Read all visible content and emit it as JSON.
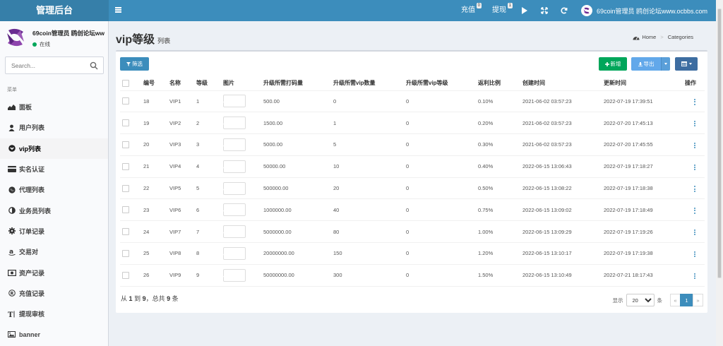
{
  "header": {
    "brand": "管理后台",
    "recharge": {
      "label": "充值",
      "badge": "0"
    },
    "withdraw": {
      "label": "提现",
      "badge": "1"
    },
    "user": "69coin管理员 鸥创论坛www.ocbbs.com"
  },
  "sidebar": {
    "user_name": "69coin管理员 鸥创论坛ww",
    "status": "在线",
    "search_placeholder": "Search...",
    "menu_header": "菜单",
    "items": [
      {
        "label": "面板",
        "icon": "area-chart-icon"
      },
      {
        "label": "用户列表",
        "icon": "user-icon"
      },
      {
        "label": "vip列表",
        "icon": "chevron-circle-icon",
        "active": true
      },
      {
        "label": "实名认证",
        "icon": "credit-card-icon"
      },
      {
        "label": "代理列表",
        "icon": "globe-icon"
      },
      {
        "label": "业务员列表",
        "icon": "adjust-icon"
      },
      {
        "label": "订单记录",
        "icon": "gear-icon"
      },
      {
        "label": "交易对",
        "icon": "amazon-icon"
      },
      {
        "label": "资产记录",
        "icon": "money-icon"
      },
      {
        "label": "充值记录",
        "icon": "registered-icon"
      },
      {
        "label": "提现审核",
        "icon": "text-height-icon"
      },
      {
        "label": "banner",
        "icon": "image-icon"
      }
    ]
  },
  "page": {
    "title": "vip等级",
    "subtitle": "列表",
    "breadcrumb": {
      "home": "Home",
      "current": "Categories"
    }
  },
  "toolbar": {
    "filter": "筛选",
    "add": "新增",
    "export": "导出"
  },
  "table": {
    "columns": [
      "编号",
      "名称",
      "等级",
      "图片",
      "升级所需打码量",
      "升级所需vip数量",
      "升级所需vip等级",
      "返利比例",
      "创建时间",
      "更新时间",
      "操作"
    ],
    "rows": [
      {
        "id": "18",
        "name": "VIP1",
        "level": "1",
        "bet": "500.00",
        "vip_count": "0",
        "vip_level": "0",
        "rebate": "0.10%",
        "created": "2021-06-02 03:57:23",
        "updated": "2022-07-19 17:39:51",
        "color_a": "#a9c4ea",
        "color_b": "#5d8fd0"
      },
      {
        "id": "19",
        "name": "VIP2",
        "level": "2",
        "bet": "1500.00",
        "vip_count": "1",
        "vip_level": "0",
        "rebate": "0.20%",
        "created": "2021-06-02 03:57:23",
        "updated": "2022-07-20 17:45:13",
        "color_a": "#9aa7c4",
        "color_b": "#6b7ba3"
      },
      {
        "id": "20",
        "name": "VIP3",
        "level": "3",
        "bet": "5000.00",
        "vip_count": "5",
        "vip_level": "0",
        "rebate": "0.30%",
        "created": "2021-06-02 03:57:23",
        "updated": "2022-07-20 17:45:55",
        "color_a": "#c6c3ec",
        "color_b": "#918bd6"
      },
      {
        "id": "21",
        "name": "VIP4",
        "level": "4",
        "bet": "50000.00",
        "vip_count": "10",
        "vip_level": "0",
        "rebate": "0.40%",
        "created": "2022-06-15 13:06:43",
        "updated": "2022-07-19 17:18:27",
        "color_a": "#f3dcb8",
        "color_b": "#e7be85"
      },
      {
        "id": "22",
        "name": "VIP5",
        "level": "5",
        "bet": "500000.00",
        "vip_count": "20",
        "vip_level": "0",
        "rebate": "0.50%",
        "created": "2022-06-15 13:08:22",
        "updated": "2022-07-19 17:18:38",
        "color_a": "#e9b39a",
        "color_b": "#c77a58"
      },
      {
        "id": "23",
        "name": "VIP6",
        "level": "6",
        "bet": "1000000.00",
        "vip_count": "40",
        "vip_level": "0",
        "rebate": "0.75%",
        "created": "2022-06-15 13:09:02",
        "updated": "2022-07-19 17:18:49",
        "color_a": "#f1d9c2",
        "color_b": "#dcb594"
      },
      {
        "id": "24",
        "name": "VIP7",
        "level": "7",
        "bet": "5000000.00",
        "vip_count": "80",
        "vip_level": "0",
        "rebate": "1.00%",
        "created": "2022-06-15 13:09:29",
        "updated": "2022-07-19 17:19:26",
        "color_a": "#f4a470",
        "color_b": "#e06f30"
      },
      {
        "id": "25",
        "name": "VIP8",
        "level": "8",
        "bet": "20000000.00",
        "vip_count": "150",
        "vip_level": "0",
        "rebate": "1.20%",
        "created": "2022-06-15 13:10:17",
        "updated": "2022-07-19 17:19:38",
        "color_a": "#a9b677",
        "color_b": "#78894a"
      },
      {
        "id": "26",
        "name": "VIP9",
        "level": "9",
        "bet": "50000000.00",
        "vip_count": "300",
        "vip_level": "0",
        "rebate": "1.50%",
        "created": "2022-06-15 13:10:49",
        "updated": "2022-07-21 18:17:43",
        "color_a": "#50566f",
        "color_b": "#2e3247"
      }
    ]
  },
  "footer": {
    "prefix": "从",
    "from": "1",
    "to_word": "到",
    "to": "9",
    "total_word": "，总共",
    "total": "9",
    "suffix": "条",
    "show_label": "显示",
    "per_page": "20",
    "per_page_suffix": "条",
    "prev": "«",
    "page": "1",
    "next": "»"
  },
  "colors": {
    "header": "#3c8dbc",
    "brand_bg": "#367fa9",
    "add_button": "#00a65a",
    "export_button": "#62a8ea",
    "columns_button": "#3d6da1",
    "online_dot": "#00a65a"
  }
}
